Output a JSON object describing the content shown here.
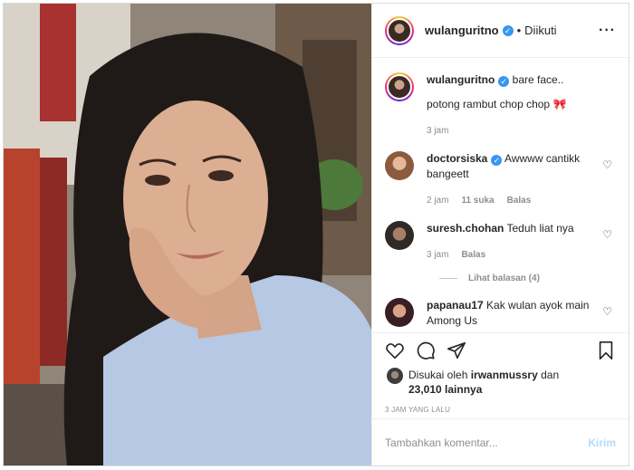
{
  "post": {
    "username": "wulanguritno",
    "follow_status": "Diikuti",
    "dot": "•",
    "verified_mark": "✓",
    "more_icon": "···",
    "caption": "bare face..",
    "caption_line2": "potong rambut chop chop",
    "caption_emoji": "🎀",
    "caption_time": "3 jam"
  },
  "comments": [
    {
      "username": "doctorsiska",
      "verified": true,
      "text": "Awwww cantikk bangeett",
      "time": "2 jam",
      "likes": "11 suka",
      "reply": "Balas"
    },
    {
      "username": "suresh.chohan",
      "verified": false,
      "text": "Teduh liat nya",
      "time": "3 jam",
      "reply": "Balas",
      "view_replies": "Lihat balasan (4)"
    },
    {
      "username": "papanau17",
      "verified": false,
      "text": "Kak wulan ayok main Among Us"
    }
  ],
  "likes": {
    "prefix": "Disukai oleh",
    "user": "irwanmussry",
    "conjunction": "dan",
    "others": "23,010 lainnya"
  },
  "timestamp": "3 JAM YANG LALU",
  "add_comment": {
    "placeholder": "Tambahkan komentar...",
    "post_label": "Kirim"
  },
  "icons": {
    "heart": "heart-icon",
    "comment": "comment-icon",
    "share": "share-icon",
    "save": "bookmark-icon"
  }
}
